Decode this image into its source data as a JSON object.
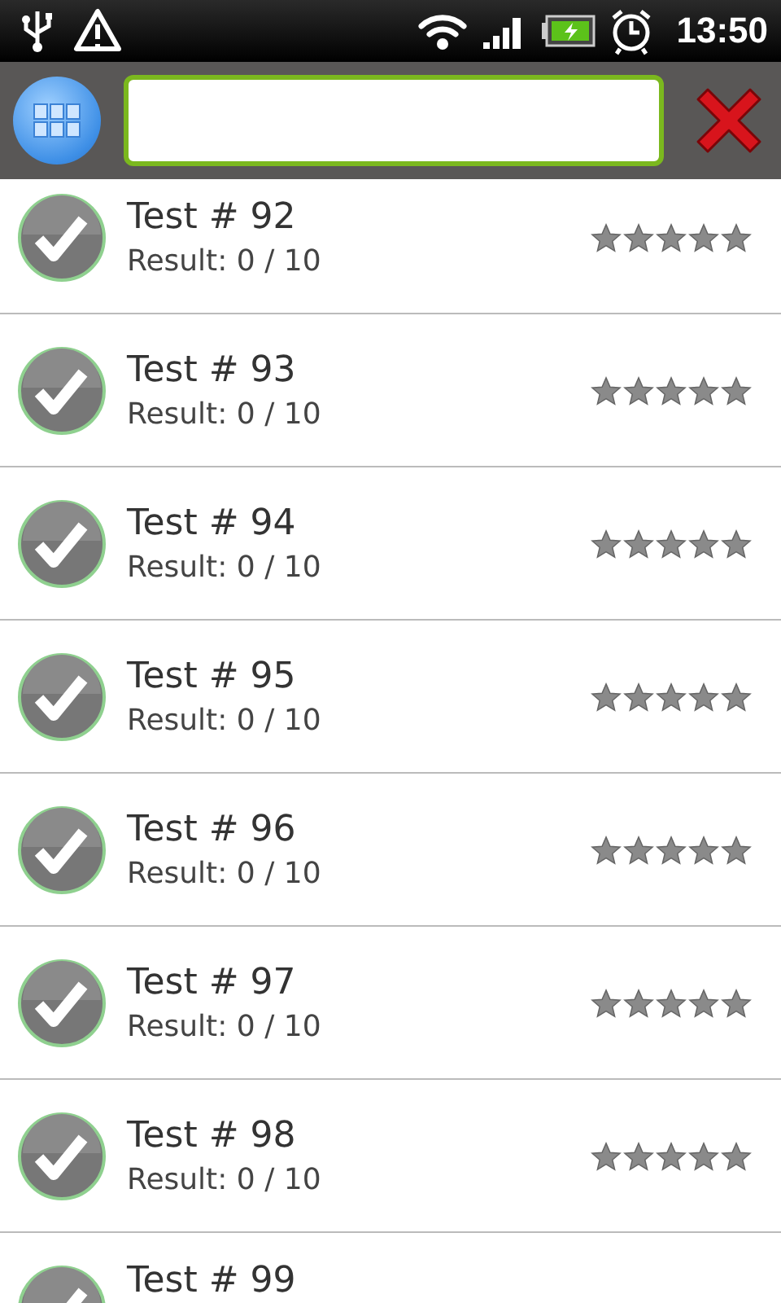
{
  "status_bar": {
    "time": "13:50"
  },
  "tests": [
    {
      "title": "Test # 92",
      "result": "Result: 0 / 10",
      "stars": 5
    },
    {
      "title": "Test # 93",
      "result": "Result: 0 / 10",
      "stars": 5
    },
    {
      "title": "Test # 94",
      "result": "Result: 0 / 10",
      "stars": 5
    },
    {
      "title": "Test # 95",
      "result": "Result: 0 / 10",
      "stars": 5
    },
    {
      "title": "Test # 96",
      "result": "Result: 0 / 10",
      "stars": 5
    },
    {
      "title": "Test # 97",
      "result": "Result: 0 / 10",
      "stars": 5
    },
    {
      "title": "Test # 98",
      "result": "Result: 0 / 10",
      "stars": 5
    },
    {
      "title": "Test # 99"
    }
  ]
}
